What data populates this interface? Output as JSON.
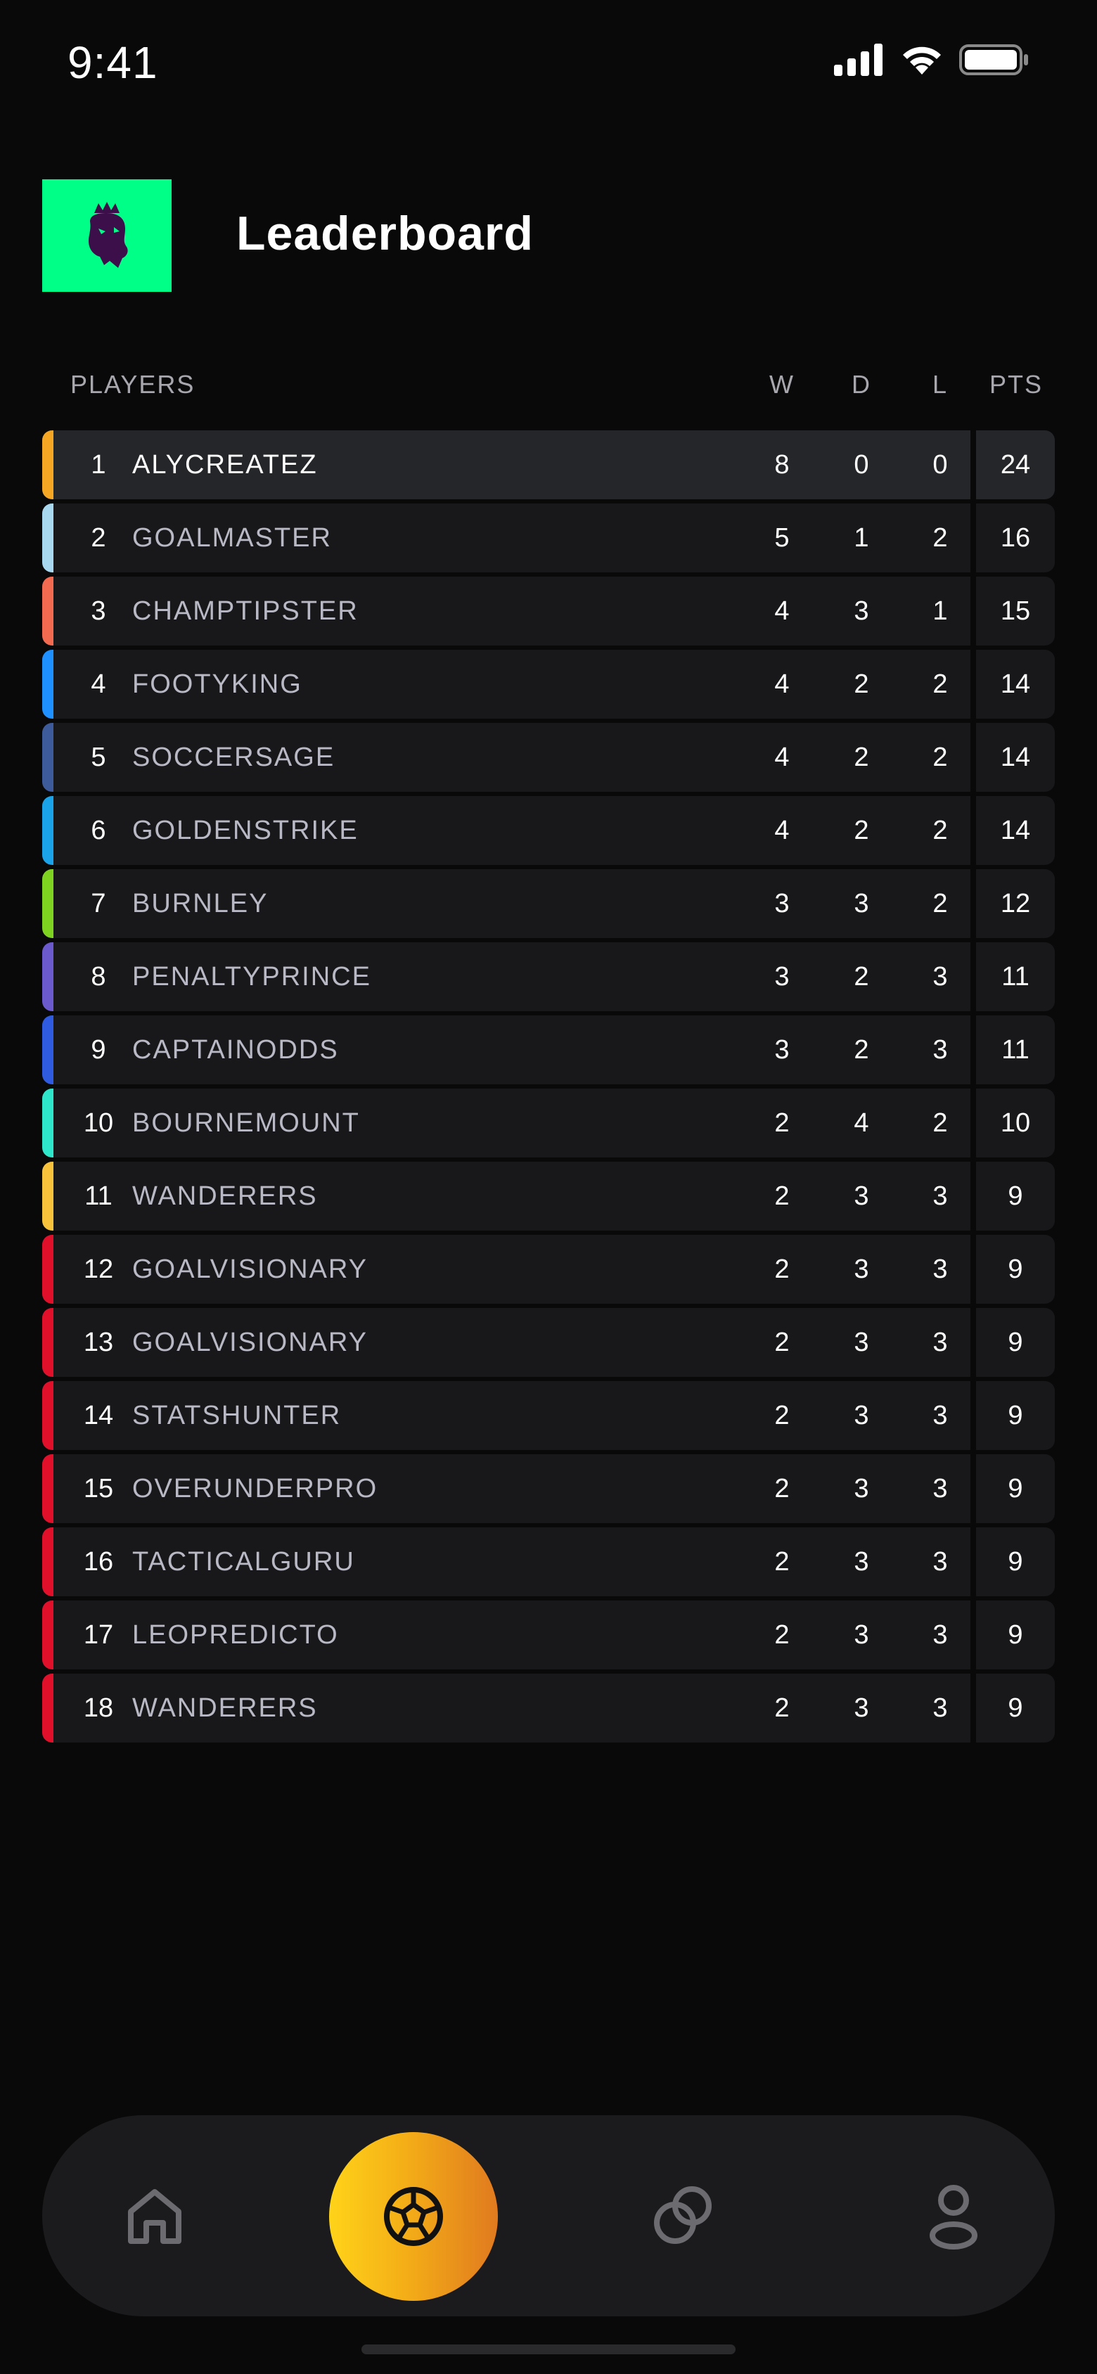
{
  "status_bar": {
    "time": "9:41"
  },
  "header": {
    "title": "Leaderboard",
    "logo_icon": "lion-crest-icon",
    "logo_bg": "#00ff87"
  },
  "table": {
    "columns": {
      "players": "PLAYERS",
      "w": "W",
      "d": "D",
      "l": "L",
      "pts": "PTS"
    },
    "rows": [
      {
        "rank": "1",
        "name": "ALYCREATEZ",
        "w": "8",
        "d": "0",
        "l": "0",
        "pts": "24",
        "accent": "#f5a623"
      },
      {
        "rank": "2",
        "name": "GOALMASTER",
        "w": "5",
        "d": "1",
        "l": "2",
        "pts": "16",
        "accent": "#a8d8f0"
      },
      {
        "rank": "3",
        "name": "CHAMPTIPSTER",
        "w": "4",
        "d": "3",
        "l": "1",
        "pts": "15",
        "accent": "#f26a4f"
      },
      {
        "rank": "4",
        "name": "FOOTYKING",
        "w": "4",
        "d": "2",
        "l": "2",
        "pts": "14",
        "accent": "#1e90ff"
      },
      {
        "rank": "5",
        "name": "SOCCERSAGE",
        "w": "4",
        "d": "2",
        "l": "2",
        "pts": "14",
        "accent": "#3d5a9a"
      },
      {
        "rank": "6",
        "name": "GOLDENSTRIKE",
        "w": "4",
        "d": "2",
        "l": "2",
        "pts": "14",
        "accent": "#1aa3e8"
      },
      {
        "rank": "7",
        "name": "BURNLEY",
        "w": "3",
        "d": "3",
        "l": "2",
        "pts": "12",
        "accent": "#7ed321"
      },
      {
        "rank": "8",
        "name": "PENALTYPRINCE",
        "w": "3",
        "d": "2",
        "l": "3",
        "pts": "11",
        "accent": "#6a5acd"
      },
      {
        "rank": "9",
        "name": "CAPTAINODDS",
        "w": "3",
        "d": "2",
        "l": "3",
        "pts": "11",
        "accent": "#2f5be0"
      },
      {
        "rank": "10",
        "name": "BOURNEMOUNT",
        "w": "2",
        "d": "4",
        "l": "2",
        "pts": "10",
        "accent": "#2ee6c9"
      },
      {
        "rank": "11",
        "name": "WANDERERS",
        "w": "2",
        "d": "3",
        "l": "3",
        "pts": "9",
        "accent": "#f8c23a"
      },
      {
        "rank": "12",
        "name": "GOALVISIONARY",
        "w": "2",
        "d": "3",
        "l": "3",
        "pts": "9",
        "accent": "#e0102a"
      },
      {
        "rank": "13",
        "name": "GOALVISIONARY",
        "w": "2",
        "d": "3",
        "l": "3",
        "pts": "9",
        "accent": "#e0102a"
      },
      {
        "rank": "14",
        "name": "STATSHUNTER",
        "w": "2",
        "d": "3",
        "l": "3",
        "pts": "9",
        "accent": "#e0102a"
      },
      {
        "rank": "15",
        "name": "OVERUNDERPRO",
        "w": "2",
        "d": "3",
        "l": "3",
        "pts": "9",
        "accent": "#e0102a"
      },
      {
        "rank": "16",
        "name": "TACTICALGURU",
        "w": "2",
        "d": "3",
        "l": "3",
        "pts": "9",
        "accent": "#e0102a"
      },
      {
        "rank": "17",
        "name": "LEOPREDICTO",
        "w": "2",
        "d": "3",
        "l": "3",
        "pts": "9",
        "accent": "#e0102a"
      },
      {
        "rank": "18",
        "name": "WANDERERS",
        "w": "2",
        "d": "3",
        "l": "3",
        "pts": "9",
        "accent": "#e0102a"
      }
    ]
  },
  "bottom_nav": {
    "items": [
      {
        "icon": "home-icon",
        "active": false
      },
      {
        "icon": "soccer-ball-icon",
        "active": true
      },
      {
        "icon": "compare-icon",
        "active": false
      },
      {
        "icon": "profile-icon",
        "active": false
      }
    ],
    "active_gradient": [
      "#ffd319",
      "#e07a1f"
    ]
  }
}
